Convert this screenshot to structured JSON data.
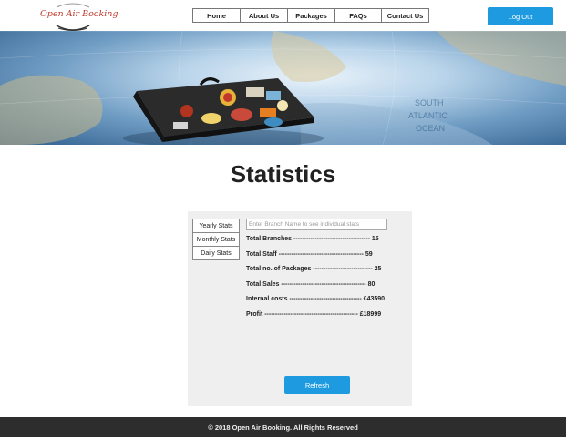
{
  "header": {
    "logo_text": "Open Air Booking",
    "nav": [
      "Home",
      "About Us",
      "Packages",
      "FAQs",
      "Contact Us"
    ],
    "logout_label": "Log Out"
  },
  "banner": {
    "image": "suitcase-on-world-map"
  },
  "main": {
    "title": "Statistics",
    "tabs": [
      "Yearly Stats",
      "Monthly Stats",
      "Daily Stats"
    ],
    "search_placeholder": "Enter Branch Name to see individual stats",
    "stats": [
      {
        "label": "Total Branches",
        "value": "15"
      },
      {
        "label": "Total Staff",
        "value": "59"
      },
      {
        "label": "Total no. of Packages",
        "value": "25"
      },
      {
        "label": "Total Sales",
        "value": "80"
      },
      {
        "label": "Internal costs",
        "value": "£43590"
      },
      {
        "label": "Profit",
        "value": "£18999"
      }
    ],
    "refresh_label": "Refresh"
  },
  "footer": {
    "text": "© 2018 Open Air Booking. All Rights Reserved"
  },
  "colors": {
    "accent": "#1e9be0",
    "footer_bg": "#2d2d2d",
    "panel_bg": "#efefef",
    "logo": "#c0392b"
  }
}
